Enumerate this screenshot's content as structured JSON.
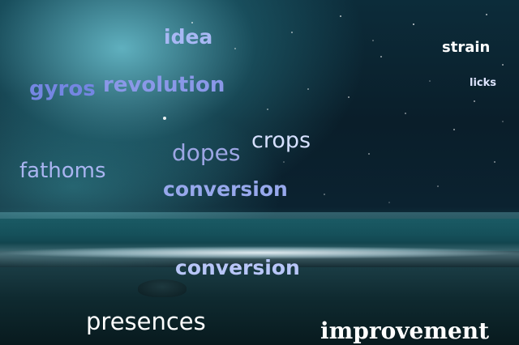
{
  "scene": {
    "description_colors": {
      "sky_glow": "#6ec8d7",
      "sea": "#1a5a64",
      "sand": "#0f2a30"
    }
  },
  "words": {
    "idea": "idea",
    "strain": "strain",
    "gyros": "gyros",
    "revolution": "revolution",
    "licks": "licks",
    "crops": "crops",
    "dopes": "dopes",
    "fathoms": "fathoms",
    "conversion_1": "conversion",
    "conversion_2": "conversion",
    "presences": "presences",
    "improvement": "improvement"
  }
}
